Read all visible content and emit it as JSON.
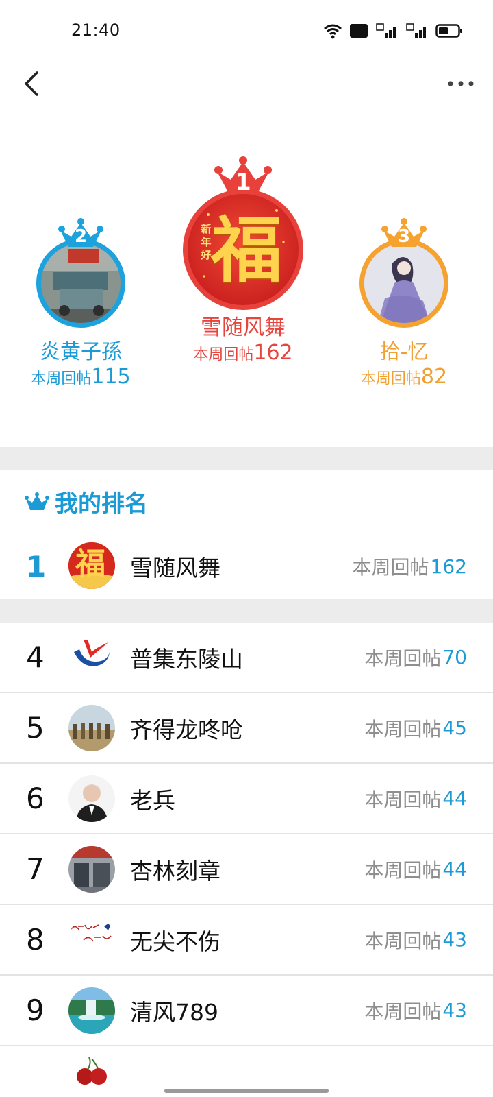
{
  "status": {
    "time": "21:40",
    "hd_label": "HD",
    "net1": "4G",
    "net2": "4G"
  },
  "colors": {
    "blue": "#1c9ad6",
    "red": "#e5453d",
    "orange": "#f0a032",
    "gray_text": "#8e8e8e",
    "divider": "#ececec"
  },
  "podium": [
    {
      "rank": "1",
      "name": "雪随风舞",
      "score_label": "本周回帖",
      "score": "162",
      "avatar": "fu-avatar",
      "fu_char": "福",
      "fu_tag": "新年好"
    },
    {
      "rank": "2",
      "name": "炎黄子孫",
      "score_label": "本周回帖",
      "score": "115",
      "avatar": "truck-photo-avatar"
    },
    {
      "rank": "3",
      "name": "拾-忆",
      "score_label": "本周回帖",
      "score": "82",
      "avatar": "lady-illustration-avatar"
    }
  ],
  "my_rank": {
    "title": "我的排名",
    "rank": "1",
    "name": "雪随风舞",
    "score_label": "本周回帖",
    "score": "162",
    "avatar_char": "福"
  },
  "list": [
    {
      "rank": "4",
      "name": "普集东陵山",
      "score_label": "本周回帖",
      "score": "70",
      "avatar": "red-blue-logo-avatar"
    },
    {
      "rank": "5",
      "name": "齐得龙咚呛",
      "score_label": "本周回帖",
      "score": "45",
      "avatar": "group-photo-avatar"
    },
    {
      "rank": "6",
      "name": "老兵",
      "score_label": "本周回帖",
      "score": "44",
      "avatar": "portrait-avatar"
    },
    {
      "rank": "7",
      "name": "杏林刻章",
      "score_label": "本周回帖",
      "score": "44",
      "avatar": "shopfront-avatar"
    },
    {
      "rank": "8",
      "name": "无尖不伤",
      "score_label": "本周回帖",
      "score": "43",
      "avatar": "calligraphy-avatar"
    },
    {
      "rank": "9",
      "name": "清风789",
      "score_label": "本周回帖",
      "score": "43",
      "avatar": "waterfall-avatar"
    }
  ]
}
